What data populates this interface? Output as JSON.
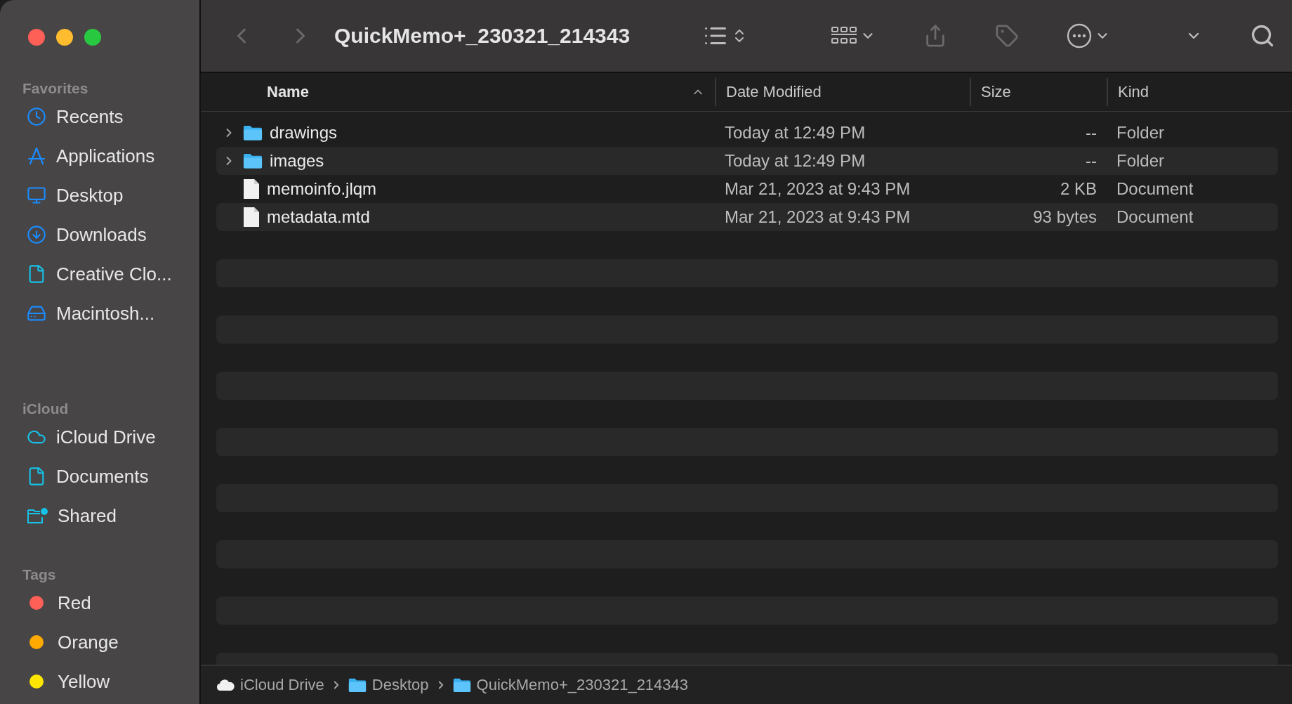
{
  "window": {
    "title": "QuickMemo+_230321_214343"
  },
  "sidebar": {
    "sections": [
      {
        "heading": "Favorites",
        "items": [
          {
            "label": "Recents",
            "kind": "recents"
          },
          {
            "label": "Applications",
            "kind": "applications"
          },
          {
            "label": "Desktop",
            "kind": "desktop"
          },
          {
            "label": "Downloads",
            "kind": "downloads"
          },
          {
            "label": "Creative Clo...",
            "kind": "document"
          },
          {
            "label": "Macintosh...",
            "kind": "disk"
          }
        ]
      },
      {
        "heading": "iCloud",
        "items": [
          {
            "label": "iCloud Drive",
            "kind": "cloud"
          },
          {
            "label": "Documents",
            "kind": "document"
          },
          {
            "label": "Shared",
            "kind": "shared"
          }
        ]
      },
      {
        "heading": "Tags",
        "items": [
          {
            "label": "Red",
            "kind": "tag",
            "color": "#fe5f57"
          },
          {
            "label": "Orange",
            "kind": "tag",
            "color": "#feaa00"
          },
          {
            "label": "Yellow",
            "kind": "tag",
            "color": "#fee600"
          }
        ]
      }
    ]
  },
  "table": {
    "columns": [
      "Name",
      "Date Modified",
      "Size",
      "Kind"
    ],
    "rows": [
      {
        "name": "drawings",
        "kind": "folder",
        "date": "Today at 12:49 PM",
        "size": "--",
        "type": "Folder"
      },
      {
        "name": "images",
        "kind": "folder",
        "date": "Today at 12:49 PM",
        "size": "--",
        "type": "Folder"
      },
      {
        "name": "memoinfo.jlqm",
        "kind": "file",
        "date": "Mar 21, 2023 at 9:43 PM",
        "size": "2 KB",
        "type": "Document"
      },
      {
        "name": "metadata.mtd",
        "kind": "file",
        "date": "Mar 21, 2023 at 9:43 PM",
        "size": "93 bytes",
        "type": "Document"
      }
    ]
  },
  "path_bar": [
    {
      "label": "iCloud Drive",
      "kind": "cloud"
    },
    {
      "label": "Desktop",
      "kind": "desktop-folder"
    },
    {
      "label": "QuickMemo+_230321_214343",
      "kind": "folder"
    }
  ]
}
